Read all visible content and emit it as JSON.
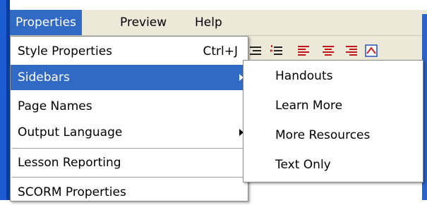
{
  "menubar": {
    "items": [
      {
        "label": "Properties",
        "active": true
      },
      {
        "label": "Preview",
        "active": false
      },
      {
        "label": "Help",
        "active": false
      }
    ]
  },
  "properties_menu": {
    "items": [
      {
        "label": "Style Properties",
        "shortcut": "Ctrl+J",
        "submenu": false,
        "highlighted": false
      },
      {
        "label": "Sidebars",
        "shortcut": "",
        "submenu": true,
        "highlighted": true
      },
      {
        "label": "Page Names",
        "shortcut": "",
        "submenu": false,
        "highlighted": false
      },
      {
        "label": "Output Language",
        "shortcut": "",
        "submenu": true,
        "highlighted": false
      },
      {
        "label": "Lesson Reporting",
        "shortcut": "",
        "submenu": false,
        "highlighted": false
      },
      {
        "label": "SCORM Properties",
        "shortcut": "",
        "submenu": false,
        "highlighted": false
      }
    ]
  },
  "sidebars_submenu": {
    "items": [
      {
        "label": "Handouts"
      },
      {
        "label": "Learn More"
      },
      {
        "label": "More Resources"
      },
      {
        "label": "Text Only"
      }
    ]
  },
  "toolbar": {
    "icons": [
      "outdent-icon",
      "indent-icon",
      "align-left-icon",
      "align-center-icon",
      "align-right-icon",
      "format-icon"
    ]
  },
  "colors": {
    "highlight": "#316ac5",
    "menubar": "#ece9d8",
    "frame_blue": "#1d5bd0"
  }
}
